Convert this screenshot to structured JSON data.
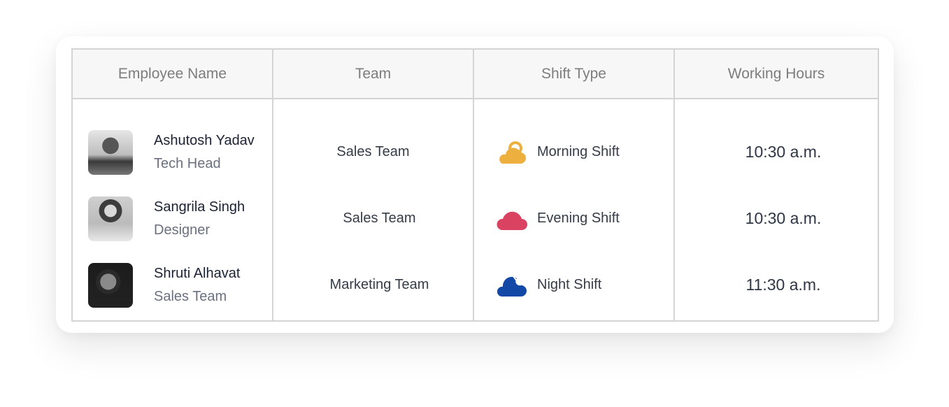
{
  "table": {
    "headers": [
      "Employee Name",
      "Team",
      "Shift Type",
      "Working Hours"
    ],
    "rows": [
      {
        "name": "Ashutosh Yadav",
        "role": "Tech Head",
        "avatar": "avatar-photo-man",
        "team": "Sales Team",
        "shift": "Morning Shift",
        "shift_icon": "sun-cloud-icon",
        "shift_color": "#EDB03E",
        "hours": "10:30 a.m."
      },
      {
        "name": "Sangrila Singh",
        "role": "Designer",
        "avatar": "avatar-photo-woman",
        "team": "Sales Team",
        "shift": "Evening Shift",
        "shift_icon": "cloud-icon",
        "shift_color": "#D94260",
        "hours": "10:30 a.m."
      },
      {
        "name": "Shruti Alhavat",
        "role": "Sales Team",
        "avatar": "avatar-photo-woman",
        "team": "Marketing Team",
        "shift": "Night Shift",
        "shift_icon": "moon-cloud-icon",
        "shift_color": "#1448A6",
        "hours": "11:30 a.m."
      }
    ]
  }
}
